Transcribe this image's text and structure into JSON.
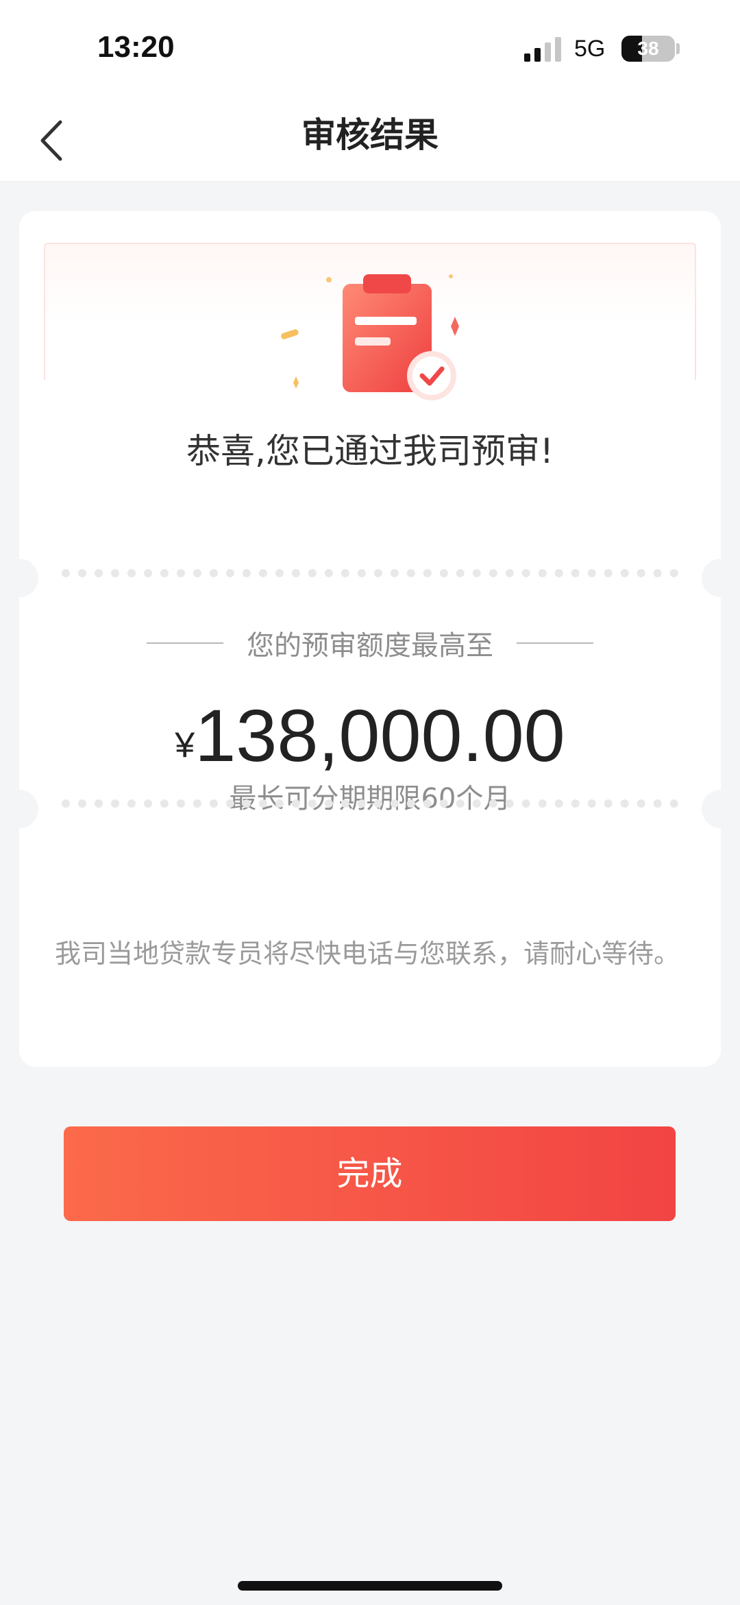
{
  "status_bar": {
    "time": "13:20",
    "network": "5G",
    "battery_level": "38",
    "battery_fraction": 0.38,
    "signal_icon": "cellular-signal-icon"
  },
  "nav": {
    "back_icon": "chevron-left-icon",
    "title": "审核结果"
  },
  "result": {
    "illustration_icon": "clipboard-check-icon",
    "congrats_text": "恭喜,您已通过我司预审!",
    "limit_label": "您的预审额度最高至",
    "currency_symbol": "¥",
    "amount": "138,000.00",
    "term_text": "最长可分期期限60个月",
    "note_text": "我司当地贷款专员将尽快电话与您联系，请耐心等待。"
  },
  "actions": {
    "done_label": "完成"
  },
  "colors": {
    "accent_start": "#fb6a4a",
    "accent_end": "#f24444",
    "background": "#f4f5f7"
  }
}
